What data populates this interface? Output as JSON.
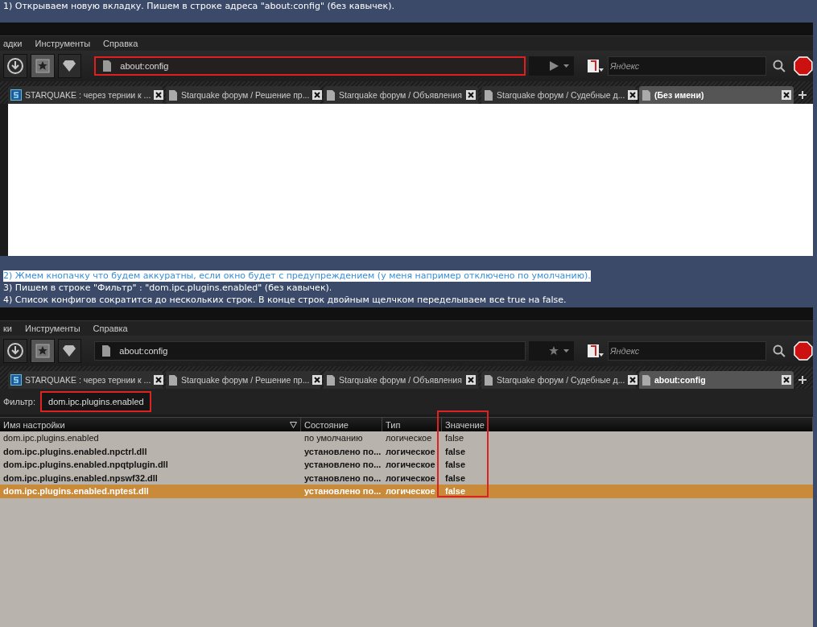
{
  "captions_top": [
    {
      "text": "1) Открываем новую вкладку. Пишем в строке адреса \"about:config\" (без кавычек).",
      "highlighted": false
    }
  ],
  "screenshots": [
    {
      "menu": [
        "адки",
        "Инструменты",
        "Справка"
      ],
      "address": {
        "value": "about:config",
        "highlighted": true,
        "kind": "go"
      },
      "search": {
        "placeholder": "Яндекс"
      },
      "tabs": [
        {
          "label": "STARQUAKE : через тернии к ...",
          "kind": "site",
          "selected": false
        },
        {
          "label": "Starquake форум / Решение пр...",
          "kind": "page",
          "selected": false
        },
        {
          "label": "Starquake форум / Объявления",
          "kind": "page",
          "selected": false
        },
        {
          "label": "Starquake форум / Судебные д...",
          "kind": "page",
          "selected": false
        },
        {
          "label": "(Без имени)",
          "kind": "page",
          "selected": true
        }
      ],
      "kind": "blank"
    },
    {
      "menu": [
        "ки",
        "Инструменты",
        "Справка"
      ],
      "address": {
        "value": "about:config",
        "highlighted": false,
        "kind": "star"
      },
      "search": {
        "placeholder": "Яндекс"
      },
      "tabs": [
        {
          "label": "STARQUAKE : через тернии к ...",
          "kind": "site",
          "selected": false
        },
        {
          "label": "Starquake форум / Решение пр...",
          "kind": "page",
          "selected": false
        },
        {
          "label": "Starquake форум / Объявления",
          "kind": "page",
          "selected": false
        },
        {
          "label": "Starquake форум / Судебные д...",
          "kind": "page",
          "selected": false
        },
        {
          "label": "about:config",
          "kind": "page",
          "selected": true
        }
      ],
      "kind": "config",
      "filter": {
        "label": "Фильтр:",
        "value": "dom.ipc.plugins.enabled",
        "highlighted": true
      },
      "table": {
        "columns": [
          {
            "label": "Имя настройки",
            "highlighted": false
          },
          {
            "label": "Состояние",
            "highlighted": false
          },
          {
            "label": "Тип",
            "highlighted": false
          },
          {
            "label": "Значение",
            "highlighted": true
          }
        ],
        "rows": [
          {
            "cells": [
              "dom.ipc.plugins.enabled",
              "по умолчанию",
              "логическое",
              "false"
            ],
            "modified": false,
            "selected": false
          },
          {
            "cells": [
              "dom.ipc.plugins.enabled.npctrl.dll",
              "установлено по...",
              "логическое",
              "false"
            ],
            "modified": true,
            "selected": false
          },
          {
            "cells": [
              "dom.ipc.plugins.enabled.npqtplugin.dll",
              "установлено по...",
              "логическое",
              "false"
            ],
            "modified": true,
            "selected": false
          },
          {
            "cells": [
              "dom.ipc.plugins.enabled.npswf32.dll",
              "установлено по...",
              "логическое",
              "false"
            ],
            "modified": true,
            "selected": false
          },
          {
            "cells": [
              "dom.ipc.plugins.enabled.nptest.dll",
              "установлено по...",
              "логическое",
              "false"
            ],
            "modified": true,
            "selected": true
          }
        ]
      }
    }
  ],
  "captions_middle": [
    {
      "text": "2) Жмем кнопачку что будем аккуратны, если окно будет с предупреждением (у меня например отключено по умолчанию).",
      "highlighted": true
    },
    {
      "text": "3) Пишем в строке \"Фильтр\" : \"dom.ipc.plugins.enabled\" (без кавычек).",
      "highlighted": false
    },
    {
      "text": "4) Список конфигов сократится до нескольких строк. В конце строк двойным щелчком переделываем все true на false.",
      "highlighted": false
    }
  ]
}
